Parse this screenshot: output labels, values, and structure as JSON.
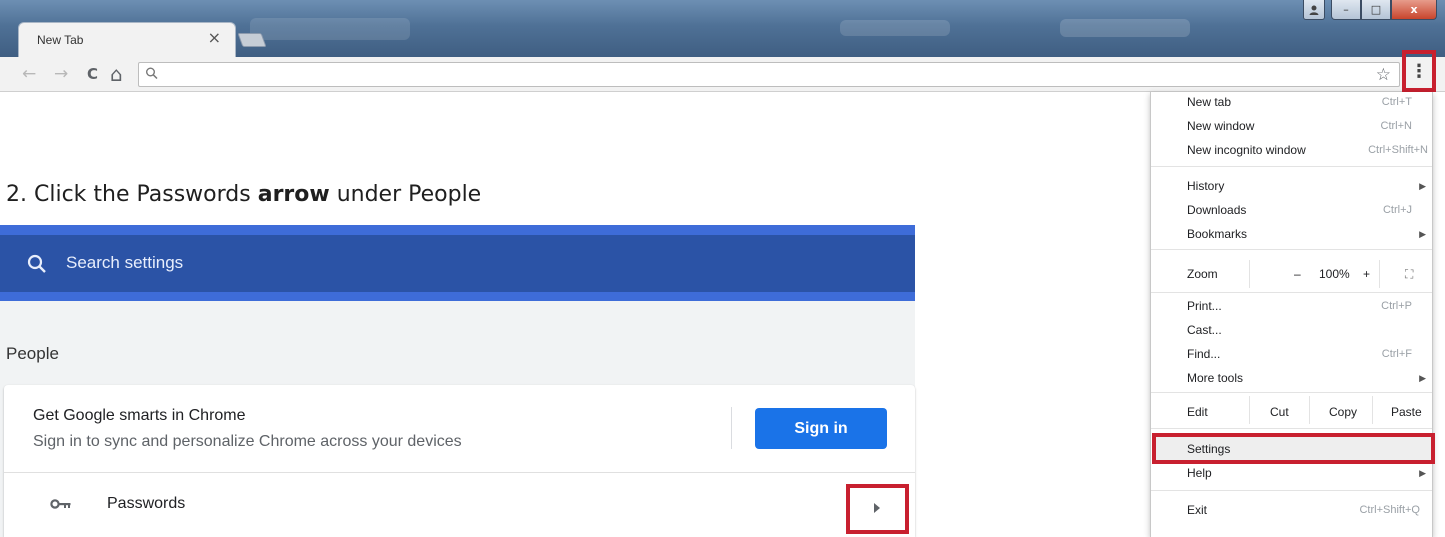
{
  "browser": {
    "tab_title": "New Tab",
    "tab_close": "×",
    "window_controls": {
      "user": "👤",
      "minimize": "–",
      "maximize": "□",
      "close": "x"
    },
    "nav": {
      "back": "←",
      "forward": "→",
      "reload": "C",
      "home": "⌂"
    },
    "omnibox_value": "",
    "star": "☆",
    "menu_button": "⋮"
  },
  "instruction": {
    "prefix": "2. Click the Passwords ",
    "bold": "arrow",
    "suffix": " under People"
  },
  "settings": {
    "search_placeholder": "Search settings",
    "people_heading": "People",
    "card_title": "Get Google smarts in Chrome",
    "card_subtitle": "Sign in to sync and personalize Chrome across your devices",
    "signin_label": "Sign in",
    "passwords_label": "Passwords",
    "colors": {
      "search_bar": "#2b53a6",
      "accent": "#3e6cd8",
      "signin": "#1a73e8",
      "highlight_box": "#c8202f"
    }
  },
  "menu": {
    "new_tab": "New tab",
    "new_tab_key": "Ctrl+T",
    "new_window": "New window",
    "new_window_key": "Ctrl+N",
    "new_incognito": "New incognito window",
    "new_incognito_key": "Ctrl+Shift+N",
    "history": "History",
    "downloads": "Downloads",
    "downloads_key": "Ctrl+J",
    "bookmarks": "Bookmarks",
    "zoom": "Zoom",
    "zoom_minus": "–",
    "zoom_value": "100%",
    "zoom_plus": "+",
    "fullscreen": "⛶",
    "print": "Print...",
    "print_key": "Ctrl+P",
    "cast": "Cast...",
    "find": "Find...",
    "find_key": "Ctrl+F",
    "more_tools": "More tools",
    "edit": "Edit",
    "cut": "Cut",
    "copy": "Copy",
    "paste": "Paste",
    "settings": "Settings",
    "help": "Help",
    "exit": "Exit",
    "exit_key": "Ctrl+Shift+Q",
    "submenu_arrow": "▶"
  }
}
